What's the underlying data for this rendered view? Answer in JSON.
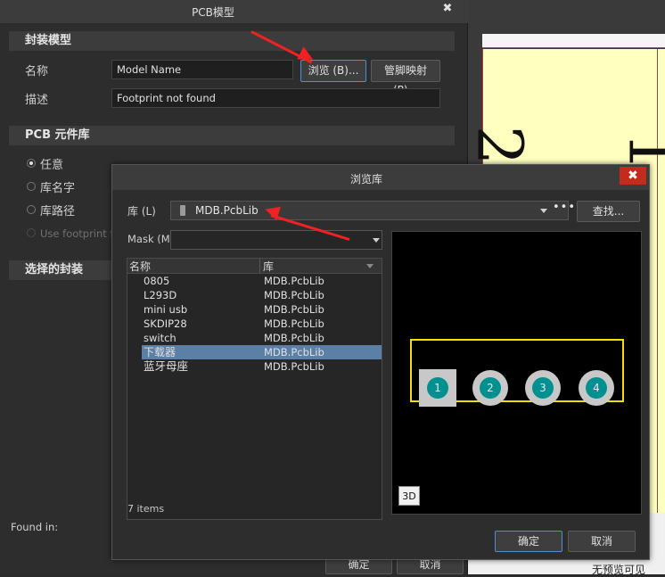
{
  "pcb_dialog": {
    "title": "PCB模型",
    "close_glyph": "✖",
    "section_model": "封装模型",
    "name_label": "名称",
    "name_value": "Model Name",
    "browse_btn": "浏览 (B)...",
    "pin_map_btn": "管脚映射 (P)...",
    "desc_label": "描述",
    "desc_value": "Footprint not found",
    "section_lib": "PCB 元件库",
    "radio_any": "任意",
    "radio_libname": "库名字",
    "radio_libpath": "库路径",
    "use_footprint": "Use footprint fr",
    "section_selected": "选择的封装",
    "found_in": "Found in:",
    "ok_btn_partial": "确定",
    "cancel_btn_partial": "取消"
  },
  "browse_dialog": {
    "title": "浏览库",
    "close_glyph": "✖",
    "lib_label": "库 (L)",
    "lib_value": "MDB.PcbLib",
    "find_btn": "查找...",
    "mask_label": "Mask (M)",
    "mask_value": "",
    "col_name": "名称",
    "col_lib": "库",
    "items": [
      {
        "name": "0805",
        "lib": "MDB.PcbLib"
      },
      {
        "name": "L293D",
        "lib": "MDB.PcbLib"
      },
      {
        "name": "mini usb",
        "lib": "MDB.PcbLib"
      },
      {
        "name": "SKDIP28",
        "lib": "MDB.PcbLib"
      },
      {
        "name": "switch",
        "lib": "MDB.PcbLib"
      },
      {
        "name": "下载器",
        "lib": "MDB.PcbLib"
      },
      {
        "name": "蓝牙母座",
        "lib": "MDB.PcbLib"
      }
    ],
    "item_count": "7 items",
    "btn_3d": "3D",
    "pads": [
      "1",
      "2",
      "3",
      "4"
    ],
    "ok_btn": "确定",
    "cancel_btn": "取消"
  },
  "background": {
    "status_text": "无预览可见",
    "glyph_a": "2",
    "glyph_b": "1"
  },
  "colors": {
    "accent": "#4a90d9",
    "selection": "#5c7fa8",
    "pad_center": "#009090",
    "outline": "#f0e000",
    "arrow": "#ee2222",
    "close_red": "#c42b1c"
  }
}
